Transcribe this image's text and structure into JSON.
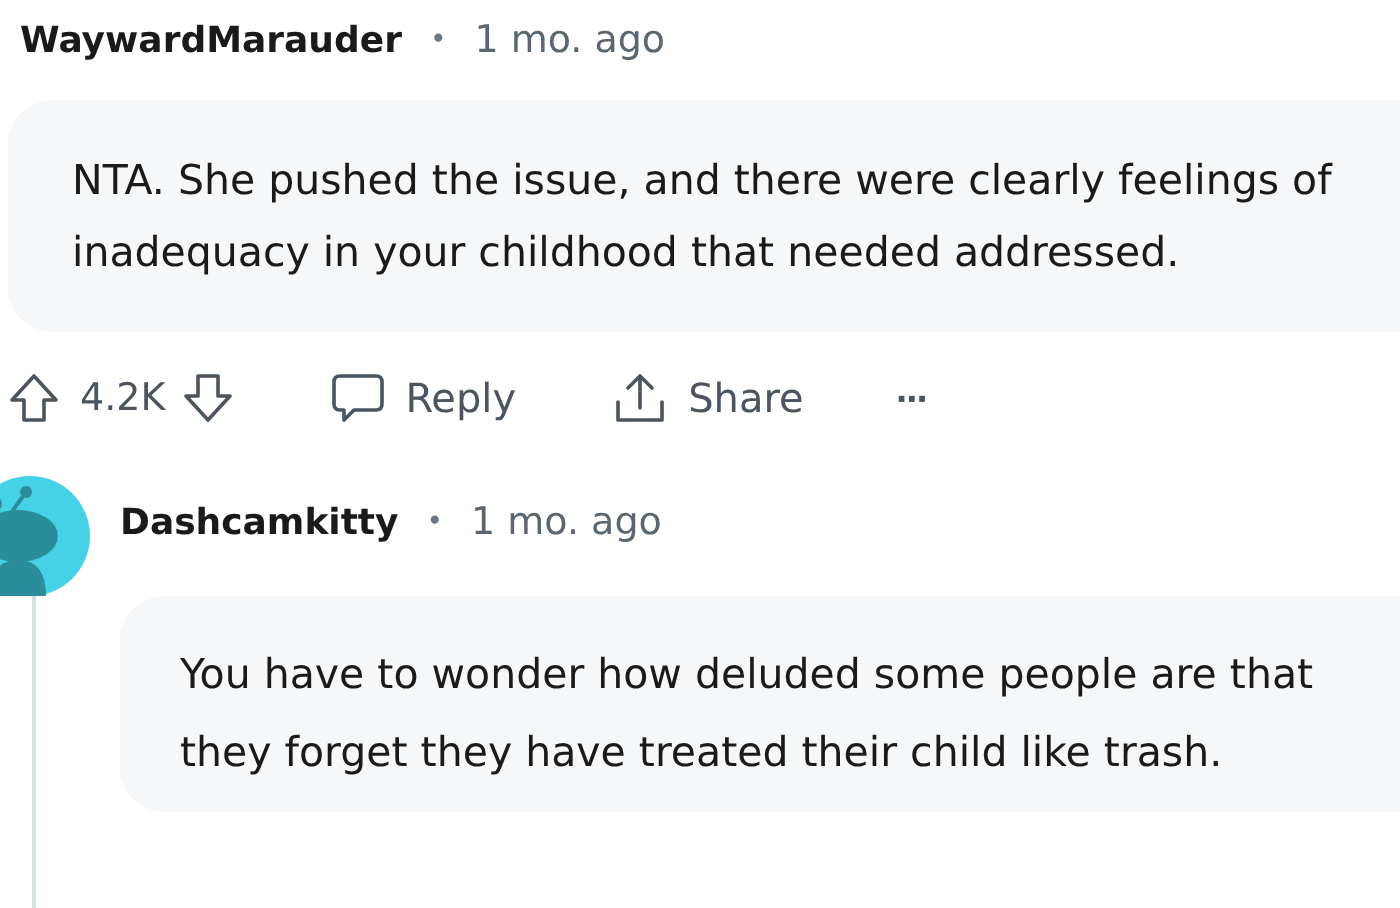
{
  "comments": [
    {
      "author": "WaywardMarauder",
      "separator": "•",
      "time": "1 mo. ago",
      "body": "NTA. She pushed the issue, and there were clearly feelings of inadequacy in your childhood that needed addressed.",
      "actions": {
        "score": "4.2K",
        "reply": "Reply",
        "share": "Share",
        "more": "···"
      }
    },
    {
      "author": "Dashcamkitty",
      "separator": "•",
      "time": "1 mo. ago",
      "body": "You have to wonder how deluded some people are that they forget they have treated their child like trash."
    }
  ]
}
